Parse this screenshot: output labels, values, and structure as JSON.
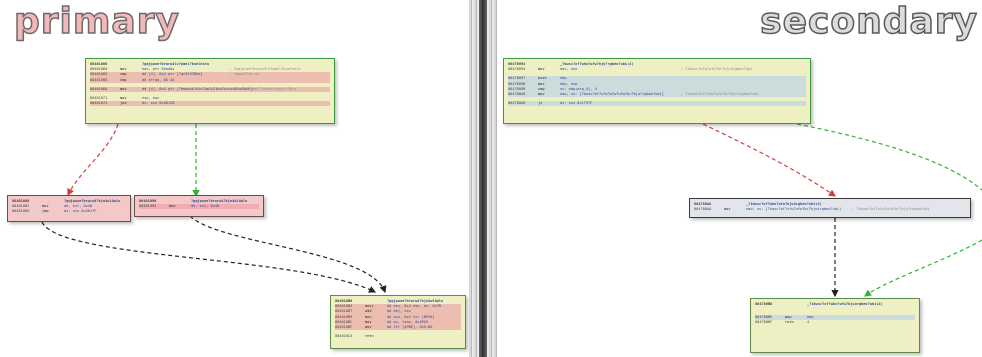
{
  "titles": {
    "primary": "primary",
    "secondary": "secondary"
  },
  "colors": {
    "true_edge": "#2fb52f",
    "false_edge": "#d63a3a",
    "uncond_edge": "#222222",
    "block_fill": "#eef0c4",
    "red_block_fill": "#f3c8c8",
    "grey_block_fill": "#e2e6ea"
  },
  "primary": {
    "top_block": {
      "lines": [
        {
          "addr": "00401060",
          "mn": "",
          "op": "?gqjpuxe?brwrw4lv?pmel?knelhnru",
          "cm": "",
          "cls": "hdr"
        },
        {
          "addr": "00401060",
          "mn": "mov",
          "op": "eax, ptr ReadAs",
          "cm": "; ?gqjpuxe?brwrw4lv?pmel?knelhnru",
          "cls": ""
        },
        {
          "addr": "00401065",
          "mn": "cmp",
          "op": "dd [4], 0x4 ptr [?gc5252Bkb]",
          "cm": "; ?gqu4l?wt.wl",
          "cls": "hl"
        },
        {
          "addr": "00401068",
          "mn": "cmp",
          "op": "dd sfraq, 0X 4A",
          "cm": "",
          "cls": "hl"
        },
        {
          "addr": "",
          "mn": "",
          "op": "",
          "cm": "",
          "cls": "gap"
        },
        {
          "addr": "0040106A",
          "mn": "mov",
          "op": "dd [4], 0x4 ptr [?bmswsk?bin?pmlw?bte?brwrw4lv?bin]",
          "cm": "; ?bmswsk?pmel?ahwe4hruw4lv?bin",
          "cls": "hl"
        },
        {
          "addr": "",
          "mn": "",
          "op": "",
          "cm": "",
          "cls": "gap"
        },
        {
          "addr": "00401071",
          "mn": "mov",
          "op": "esp, eax",
          "cm": "",
          "cls": ""
        },
        {
          "addr": "00401074",
          "mn": "jne",
          "op": "ds: xxx 0x4012B",
          "cm": "",
          "cls": "hl"
        }
      ]
    },
    "left_block": {
      "lines": [
        {
          "addr": "00401080",
          "mn": "",
          "op": "?gqjpuxe?brwrw4?kju4wl4wln",
          "cm": "",
          "cls": "hdr"
        },
        {
          "addr": "00401082",
          "mn": "mov",
          "op": "dd, ecl, 0x40",
          "cm": "",
          "cls": ""
        },
        {
          "addr": "00401085",
          "mn": "jmp",
          "op": "ds: xxx 0x4017F",
          "cm": "",
          "cls": ""
        }
      ]
    },
    "mid_block": {
      "lines": [
        {
          "addr": "00401090",
          "mn": "",
          "op": "?gqjpuxe?brwrw4?kju4wl4wln",
          "cm": "",
          "cls": "hdr"
        },
        {
          "addr": "00401093",
          "mn": "mov",
          "op": "dd, esi, 0x40",
          "cm": "",
          "cls": "hl"
        }
      ]
    },
    "bottom_block": {
      "lines": [
        {
          "addr": "004010B0",
          "mn": "",
          "op": "?gqjpuxe?brwrw4?kju4wl4wln",
          "cm": "",
          "cls": "hdr"
        },
        {
          "addr": "004010B4",
          "mn": "movz",
          "op": "dd esx, 0x4 esp, ds: 0x7B",
          "cm": "",
          "cls": "hl"
        },
        {
          "addr": "004010B7",
          "mn": "add",
          "op": "dd ebj, esx",
          "cm": "",
          "cls": "hl"
        },
        {
          "addr": "004010B9",
          "mn": "mov",
          "op": "dd esx, 0x4 ttr [BP50]",
          "cm": "",
          "cls": "hl"
        },
        {
          "addr": "004010BC",
          "mn": "mov",
          "op": "dd wx, taay, 0x4PUS",
          "cm": "",
          "cls": "hl"
        },
        {
          "addr": "004010BF",
          "mn": "mov",
          "op": "dd ttr [4PNE], 0x5:8A",
          "cm": "",
          "cls": "hl"
        },
        {
          "addr": "",
          "mn": "",
          "op": "",
          "cm": "",
          "cls": "gap"
        },
        {
          "addr": "004010C4",
          "mn": "retn",
          "op": "",
          "cm": "",
          "cls": ""
        }
      ]
    }
  },
  "secondary": {
    "top_block": {
      "lines": [
        {
          "addr": "00478094",
          "mn": "",
          "op": "_?kwsc?of?who?ufw?kju?rgbeo?ubi(4)",
          "cm": "",
          "cls": "hdr"
        },
        {
          "addr": "00478094",
          "mn": "mov",
          "op": "eax, eax",
          "cm": "; ?ikwsc?ofw?ufw?br?kju4rgbeo?ubi",
          "cls": ""
        },
        {
          "addr": "",
          "mn": "",
          "op": "",
          "cm": "",
          "cls": "gap"
        },
        {
          "addr": "00478097",
          "mn": "push",
          "op": "ebp",
          "cm": "",
          "cls": "hl2"
        },
        {
          "addr": "00478098",
          "mn": "mov",
          "op": "ebp, esp",
          "cm": "",
          "cls": "hl2"
        },
        {
          "addr": "0047809B",
          "mn": "cmp",
          "op": "ss: ebp+arg_0], 4",
          "cm": "",
          "cls": "hl2"
        },
        {
          "addr": "004780A0",
          "mn": "mov",
          "op": "eaw, ss: [?kwsc?of?ufw?wfw?ufw?br?kju?rgbeo?ubi]",
          "cm": "; ?ikwsc?of?ufw?ufw?br?kju?rgbeo?ubi",
          "cls": "hl2"
        },
        {
          "addr": "",
          "mn": "",
          "op": "",
          "cm": "",
          "cls": "gap"
        },
        {
          "addr": "004780A6",
          "mn": "jz",
          "op": "ds: xxx 0x1757F",
          "cm": "",
          "cls": "hl2"
        }
      ]
    },
    "mid_block": {
      "lines": [
        {
          "addr": "004780A8",
          "mn": "",
          "op": "_?ikwsc?of?who?ufw?kju4rgbeo?ubi(4)",
          "cm": "",
          "cls": "hdr"
        },
        {
          "addr": "004780AA",
          "mn": "mov",
          "op": "eaw, ss: [?kwsc?of?ufw?ufw?br?kju4rgbeo?ubi]",
          "cm": "; ?ikwsc?of?ufw?ufw?br?kju?rgbeo?ubi",
          "cls": ""
        }
      ]
    },
    "bottom_block": {
      "lines": [
        {
          "addr": "004780B8",
          "mn": "",
          "op": "_?ikwsc?of?who?ufw?kju4rgbeo?ubi(4)",
          "cm": "",
          "cls": "hdr"
        },
        {
          "addr": "",
          "mn": "",
          "op": "",
          "cm": "",
          "cls": "gap"
        },
        {
          "addr": "",
          "mn": "",
          "op": "",
          "cm": "",
          "cls": "gap"
        },
        {
          "addr": "004780BE",
          "mn": "pop",
          "op": "ebp",
          "cm": "",
          "cls": "hl2"
        },
        {
          "addr": "004780BF",
          "mn": "retn",
          "op": "4",
          "cm": "",
          "cls": ""
        }
      ]
    }
  }
}
